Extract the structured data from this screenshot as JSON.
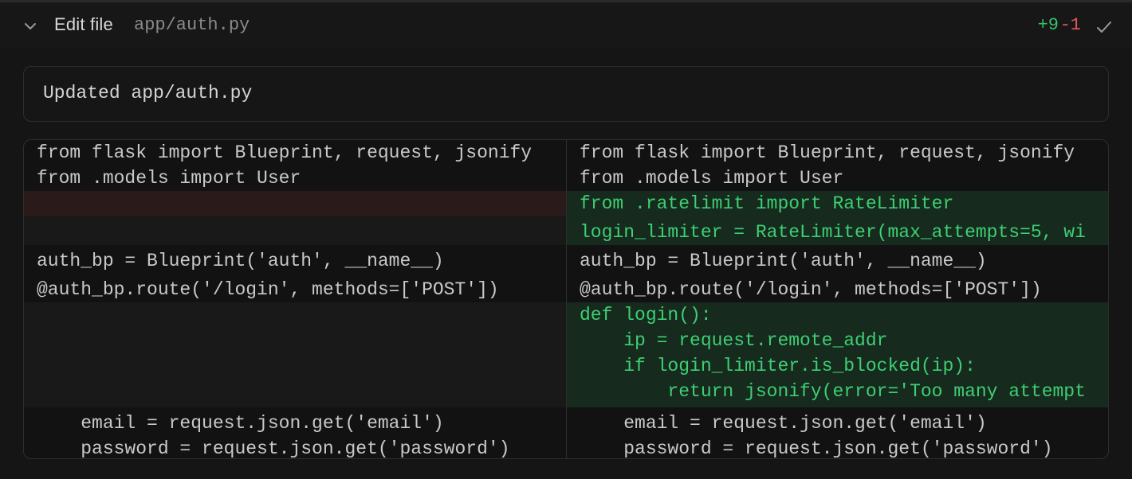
{
  "header": {
    "title": "Edit file",
    "path": "app/auth.py",
    "additions": "+9",
    "deletions": "-1",
    "status_icon": "check-icon",
    "toggle_icon": "chevron-down-icon"
  },
  "message": "Updated app/auth.py",
  "diff": {
    "left": [
      "from flask import Blueprint, request, jsonify",
      "from .models import User",
      "",
      "",
      "auth_bp = Blueprint('auth', __name__)",
      "@auth_bp.route('/login', methods=['POST'])",
      "",
      "",
      "",
      "",
      "    email = request.json.get('email')",
      "    password = request.json.get('password')"
    ],
    "right": [
      "from flask import Blueprint, request, jsonify",
      "from .models import User",
      "from .ratelimit import RateLimiter",
      "login_limiter = RateLimiter(max_attempts=5, wi",
      "auth_bp = Blueprint('auth', __name__)",
      "@auth_bp.route('/login', methods=['POST'])",
      "def login():",
      "    ip = request.remote_addr",
      "    if login_limiter.is_blocked(ip):",
      "        return jsonify(error='Too many attempt",
      "    email = request.json.get('email')",
      "    password = request.json.get('password')"
    ]
  },
  "colors": {
    "added_text": "#3ecf73",
    "added_bg": "#162a1e",
    "removed_bg": "#2a1a1a",
    "addition_count": "#35c26a",
    "deletion_count": "#e0565b"
  }
}
